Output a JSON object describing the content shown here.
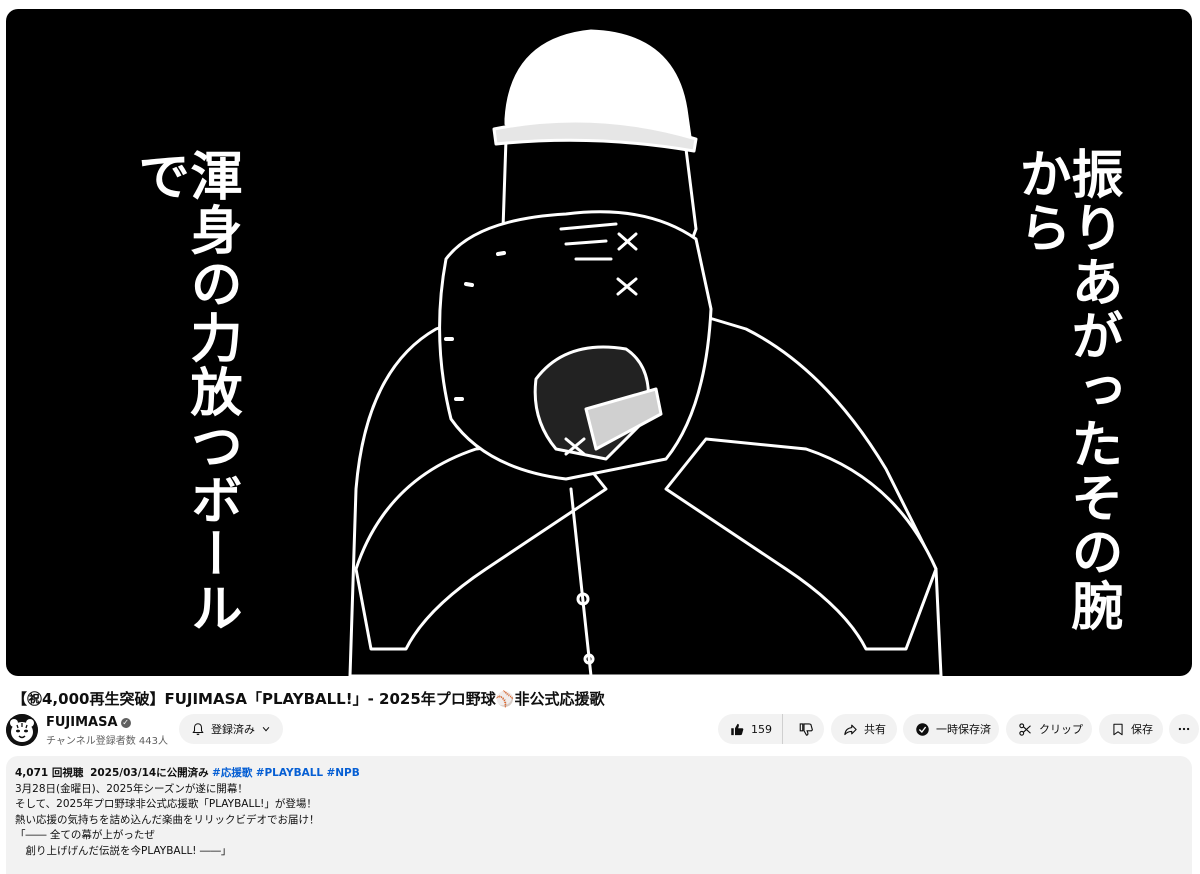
{
  "video": {
    "left_lyric": "渾身の力放つボールで",
    "right_lyric": "振りあがったその腕から"
  },
  "title": "【㊗4,000再生突破】FUJIMASA「PLAYBALL!」- 2025年プロ野球⚾非公式応援歌",
  "channel": {
    "name": "FUJIMASA",
    "subscribers": "チャンネル登録者数 443人",
    "subscribe_label": "登録済み"
  },
  "actions": {
    "like_count": "159",
    "share_label": "共有",
    "save_offline_label": "一時保存済",
    "clip_label": "クリップ",
    "save_label": "保存"
  },
  "description": {
    "views": "4,071 回視聴",
    "date": "2025/03/14に公開済み",
    "hashtags": [
      "#応援歌",
      "#PLAYBALL",
      "#NPB"
    ],
    "lines": [
      "3月28日(金曜日)、2025年シーズンが遂に開幕！",
      "そして、2025年プロ野球非公式応援歌「PLAYBALL!」が登場！",
      "熱い応援の気持ちを詰め込んだ楽曲をリリックビデオでお届け！",
      "",
      "「―― 全ての幕が上がったぜ",
      "　創り上げげんだ伝説を今PLAYBALL! ――」"
    ]
  }
}
